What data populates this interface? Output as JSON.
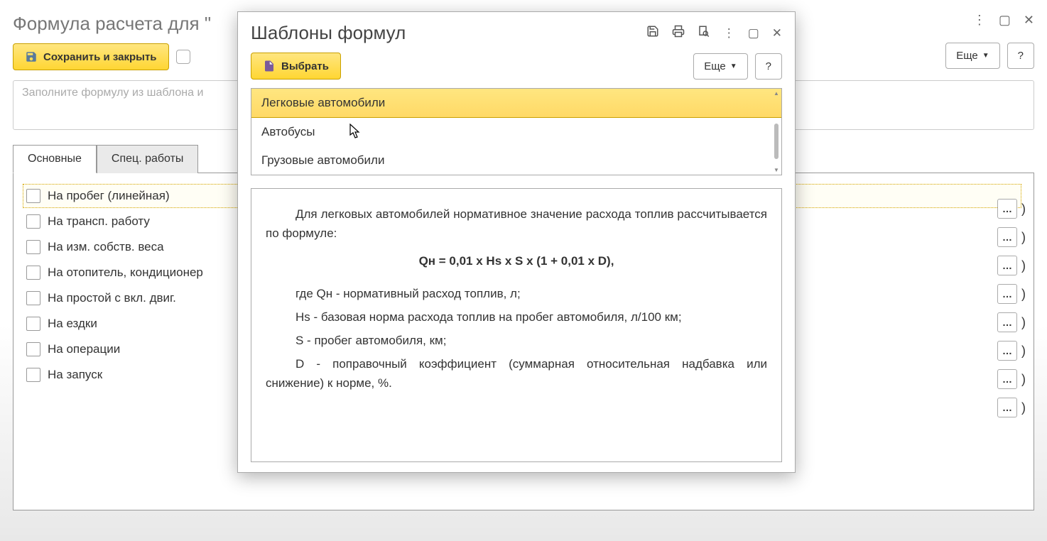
{
  "bg": {
    "title": "Формула расчета для \"",
    "save_close": "Сохранить и закрыть",
    "more": "Еще",
    "help": "?",
    "placeholder": "Заполните формулу из шаблона и",
    "tabs": {
      "main": "Основные",
      "spec": "Спец. работы"
    },
    "checks": [
      "На пробег (линейная)",
      "На трансп. работу",
      "На изм. собств. веса",
      "На отопитель, кондиционер",
      "На простой с вкл. двиг.",
      "На ездки",
      "На операции",
      "На запуск"
    ],
    "paren": ")"
  },
  "dialog": {
    "title": "Шаблоны формул",
    "select": "Выбрать",
    "more": "Еще",
    "help": "?",
    "templates": [
      "Легковые автомобили",
      "Автобусы",
      "Грузовые автомобили"
    ],
    "desc": {
      "p1": "Для легковых автомобилей нормативное значение расхода топлив рассчитывается по формуле:",
      "formula": "Qн = 0,01 x Hs x S x (1 + 0,01 x D),",
      "l1": "где Qн - нормативный расход топлив, л;",
      "l2": "Hs - базовая норма расхода топлив на пробег автомобиля, л/100 км;",
      "l3": "S - пробег автомобиля, км;",
      "l4": "D - поправочный коэффициент (суммарная относительная надбавка или снижение) к норме, %."
    }
  }
}
